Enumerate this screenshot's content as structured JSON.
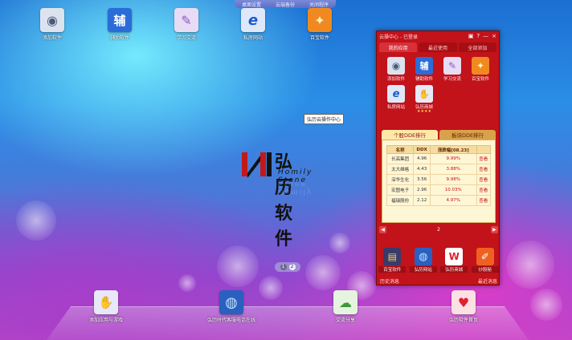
{
  "topbar": {
    "items": [
      "桌面设置",
      "云端备份",
      "关闭程序"
    ]
  },
  "desktop_icons": [
    {
      "label": "添加软件",
      "icon": "cd-icon",
      "glyph": "◉",
      "color": "#5a6a8a"
    },
    {
      "label": "辅助软件",
      "icon": "fu-icon",
      "glyph": "辅",
      "color": "#2a6cd8"
    },
    {
      "label": "学习交流",
      "icon": "pencil-icon",
      "glyph": "✎",
      "color": "#b38ad8"
    },
    {
      "label": "私房网站",
      "icon": "ie-icon",
      "glyph": "e",
      "color": "#6a9ae8"
    },
    {
      "label": "百宝软件",
      "icon": "treasure-icon",
      "glyph": "✦",
      "color": "#f08a20"
    }
  ],
  "tooltip": "弘历云操作中心",
  "logo": {
    "cn": "弘历软件",
    "en": "Homily Stone"
  },
  "pager": [
    "1",
    "2"
  ],
  "dock_icons": [
    {
      "label": "添加应用与游戏",
      "icon": "handshake-icon",
      "glyph": "✋",
      "color": "#6a70c8"
    },
    {
      "label": "弘历时代客服电话在线",
      "icon": "globe-icon",
      "glyph": "◍",
      "color": "#2a60c0"
    },
    {
      "label": "交流分享",
      "icon": "chat-icon",
      "glyph": "☁",
      "color": "#5ab84a"
    },
    {
      "label": "弘历软件首页",
      "icon": "lips-icon",
      "glyph": "♥",
      "color": "#e02030"
    }
  ],
  "panel": {
    "title": "云操中心 - 已登录",
    "controls": [
      "▣",
      "?",
      "—",
      "×"
    ],
    "tabs": [
      "我的应用",
      "最近使用",
      "全部添加"
    ],
    "apps": [
      {
        "label": "添加软件",
        "icon": "cd-icon",
        "glyph": "◉",
        "color": "#5a6a8a"
      },
      {
        "label": "辅助软件",
        "icon": "fu-icon",
        "glyph": "辅",
        "color": "#2a6cd8"
      },
      {
        "label": "学习交流",
        "icon": "pencil-icon",
        "glyph": "✎",
        "color": "#b38ad8"
      },
      {
        "label": "百宝软件",
        "icon": "treasure-icon",
        "glyph": "✦",
        "color": "#f08a20"
      },
      {
        "label": "私房网站",
        "icon": "ie-icon",
        "glyph": "e",
        "color": "#6a9ae8"
      },
      {
        "label": "弘历商城",
        "icon": "handshake-icon",
        "glyph": "✋",
        "color": "#6a70c8"
      }
    ],
    "stars": "★★★★",
    "subtabs": [
      "个股DDE排行",
      "板块DDE排行"
    ],
    "table": {
      "headers": [
        "名称",
        "DDX",
        "涨跌幅[08.23]",
        ""
      ],
      "rows": [
        {
          "name": "长高集团",
          "ddx": "4.96",
          "pct": "9.99%",
          "action": "查看"
        },
        {
          "name": "太大维格",
          "ddx": "4.43",
          "pct": "3.88%",
          "action": "查看"
        },
        {
          "name": "深华生化",
          "ddx": "3.56",
          "pct": "9.98%",
          "action": "查看"
        },
        {
          "name": "宏图电子",
          "ddx": "2.96",
          "pct": "10.03%",
          "action": "查看"
        },
        {
          "name": "福瑞股份",
          "ddx": "2.12",
          "pct": "4.97%",
          "action": "查看"
        }
      ]
    },
    "page": "2",
    "tray": [
      {
        "label": "百宝软件",
        "icon": "folder-icon",
        "glyph": "▤",
        "color": "#3a3a6a"
      },
      {
        "label": "弘历网站",
        "icon": "globe-icon",
        "glyph": "◍",
        "color": "#2a60c0"
      },
      {
        "label": "弘历商城",
        "icon": "w-logo-icon",
        "glyph": "W",
        "color": "#e02030"
      },
      {
        "label": "炒股秘",
        "icon": "pen-icon",
        "glyph": "✐",
        "color": "#f06020"
      }
    ],
    "status_left": "历史消息",
    "status_right": "最近消息"
  }
}
